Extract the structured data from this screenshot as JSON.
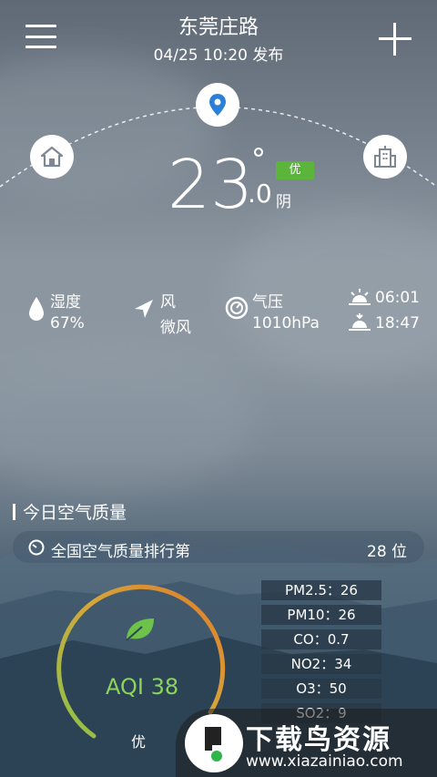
{
  "header": {
    "city": "东莞庄路",
    "publish_time": "04/25  10:20 发布"
  },
  "weather": {
    "temp_int": "23",
    "degree": "°",
    "temp_dec": ".0",
    "condition": "阴",
    "air_badge": "优",
    "air_badge_color": "#5ab53a"
  },
  "details": {
    "humidity_label": "湿度",
    "humidity_value": "67%",
    "wind_label": "风",
    "wind_value": "微风",
    "pressure_label": "气压",
    "pressure_value": "1010hPa",
    "sunrise": "06:01",
    "sunset": "18:47"
  },
  "air_quality": {
    "title": "今日空气质量",
    "rank_label": "全国空气质量排行第",
    "rank_value": "28 位",
    "aqi_text": "AQI 38",
    "aqi_value": 38,
    "level": "优",
    "pollutants": [
      "PM2.5：26",
      "PM10：26",
      "CO：0.7",
      "NO2：34",
      "O3：50",
      "SO2：9"
    ]
  },
  "watermark": {
    "title": "下载鸟资源",
    "url": "www.xiazainiao.com"
  },
  "icons": [
    "menu-icon",
    "add-icon",
    "location-icon",
    "home-icon",
    "building-icon",
    "humidity-icon",
    "wind-icon",
    "pressure-icon",
    "sunrise-icon",
    "sunset-icon",
    "leaf-icon"
  ]
}
